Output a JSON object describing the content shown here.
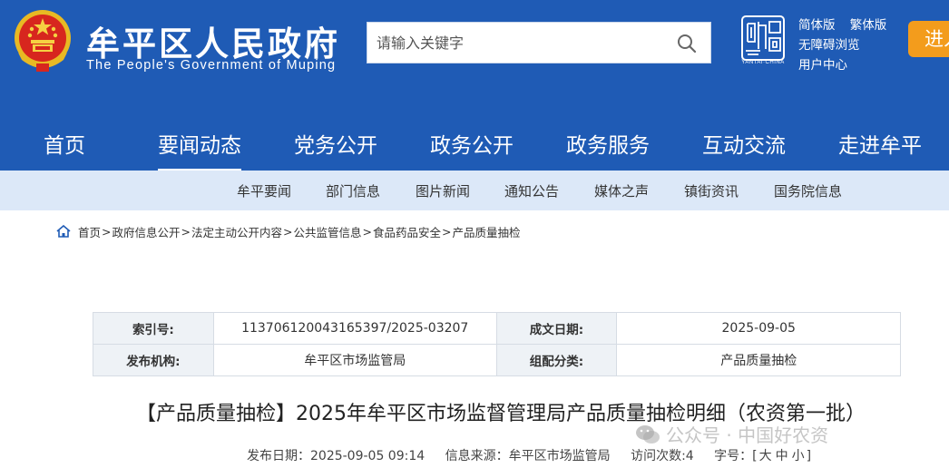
{
  "header": {
    "site_title": "牟平区人民政府",
    "site_subtitle": "The People's Government of Muping",
    "search_placeholder": "请输入关键字",
    "yantai_label": "YANTAI·CHINA",
    "quick_links": {
      "simplified": "简体版",
      "traditional": "繁体版",
      "accessible": "无障碍浏览",
      "user_center": "用户中心"
    },
    "enter_button": "进入",
    "icons": [
      "national-emblem",
      "search-icon",
      "yantai-china-logo"
    ]
  },
  "main_nav": [
    {
      "label": "首页",
      "active": false
    },
    {
      "label": "要闻动态",
      "active": true
    },
    {
      "label": "党务公开",
      "active": false
    },
    {
      "label": "政务公开",
      "active": false
    },
    {
      "label": "政务服务",
      "active": false
    },
    {
      "label": "互动交流",
      "active": false
    },
    {
      "label": "走进牟平",
      "active": false
    }
  ],
  "sub_nav": [
    "牟平要闻",
    "部门信息",
    "图片新闻",
    "通知公告",
    "媒体之声",
    "镇街资讯",
    "国务院信息"
  ],
  "breadcrumb": [
    "首页",
    "政府信息公开",
    "法定主动公开内容",
    "公共监管信息",
    "食品药品安全",
    "产品质量抽检"
  ],
  "info": {
    "index_label": "索引号:",
    "index_value": "113706120043165397/2025-03207",
    "date_label": "成文日期:",
    "date_value": "2025-09-05",
    "publisher_label": "发布机构:",
    "publisher_value": "牟平区市场监管局",
    "category_label": "组配分类:",
    "category_value": "产品质量抽检"
  },
  "article": {
    "title": "【产品质量抽检】2025年牟平区市场监督管理局产品质量抽检明细（农资第一批）",
    "publish_date": "发布日期：2025-09-05 09:14",
    "source": "信息来源：牟平区市场监管局",
    "visits": "访问次数:4",
    "font_label": "字号：[",
    "font_large": "大",
    "font_medium": "中",
    "font_small": "小",
    "font_close": "]"
  },
  "watermark": "公众号 · 中国好农资",
  "colors": {
    "header_blue": "#1f5bb5",
    "subnav_bg": "#dce8f8",
    "enter_orange": "#f39c1c",
    "table_label_bg": "#eef2f6"
  }
}
